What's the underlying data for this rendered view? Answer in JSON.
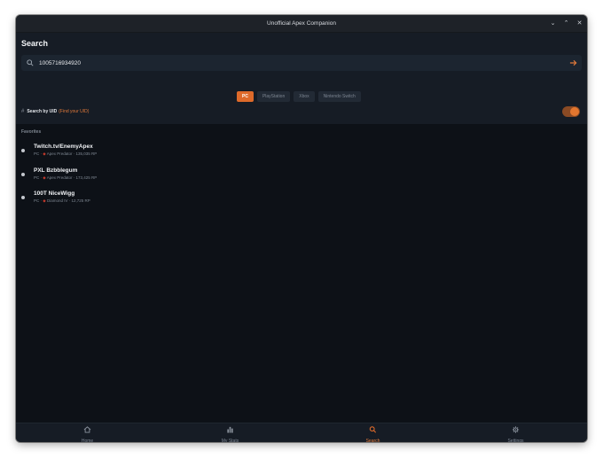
{
  "window": {
    "title": "Unofficial Apex Companion"
  },
  "page": {
    "title": "Search"
  },
  "search": {
    "value": "1005716934920"
  },
  "platforms": [
    "PC",
    "PlayStation",
    "Xbox",
    "Nintendo Switch"
  ],
  "active_platform": "PC",
  "uid": {
    "label": "Search by UID",
    "link": "(Find your UID)",
    "enabled": true
  },
  "favorites": {
    "heading": "Favorites",
    "items": [
      {
        "name": "Twitch.tv/EnemyApex",
        "platform": "PC",
        "rank": "Apex Predator",
        "rp": "135,035 RP"
      },
      {
        "name": "PXL Bzbblegum",
        "platform": "PC",
        "rank": "Apex Predator",
        "rp": "173,425 RP"
      },
      {
        "name": "100T NiceWigg",
        "platform": "PC",
        "rank": "Diamond IV",
        "rp": "12,725 RP"
      }
    ]
  },
  "nav": {
    "items": [
      {
        "label": "Home",
        "icon": "home-icon"
      },
      {
        "label": "My Stats",
        "icon": "bar-chart-icon"
      },
      {
        "label": "Search",
        "icon": "search-icon"
      },
      {
        "label": "Settings",
        "icon": "gear-icon"
      }
    ],
    "active": "Search"
  },
  "colors": {
    "accent": "#de6a2a",
    "background": "#0d1117",
    "panel": "#161c25"
  }
}
